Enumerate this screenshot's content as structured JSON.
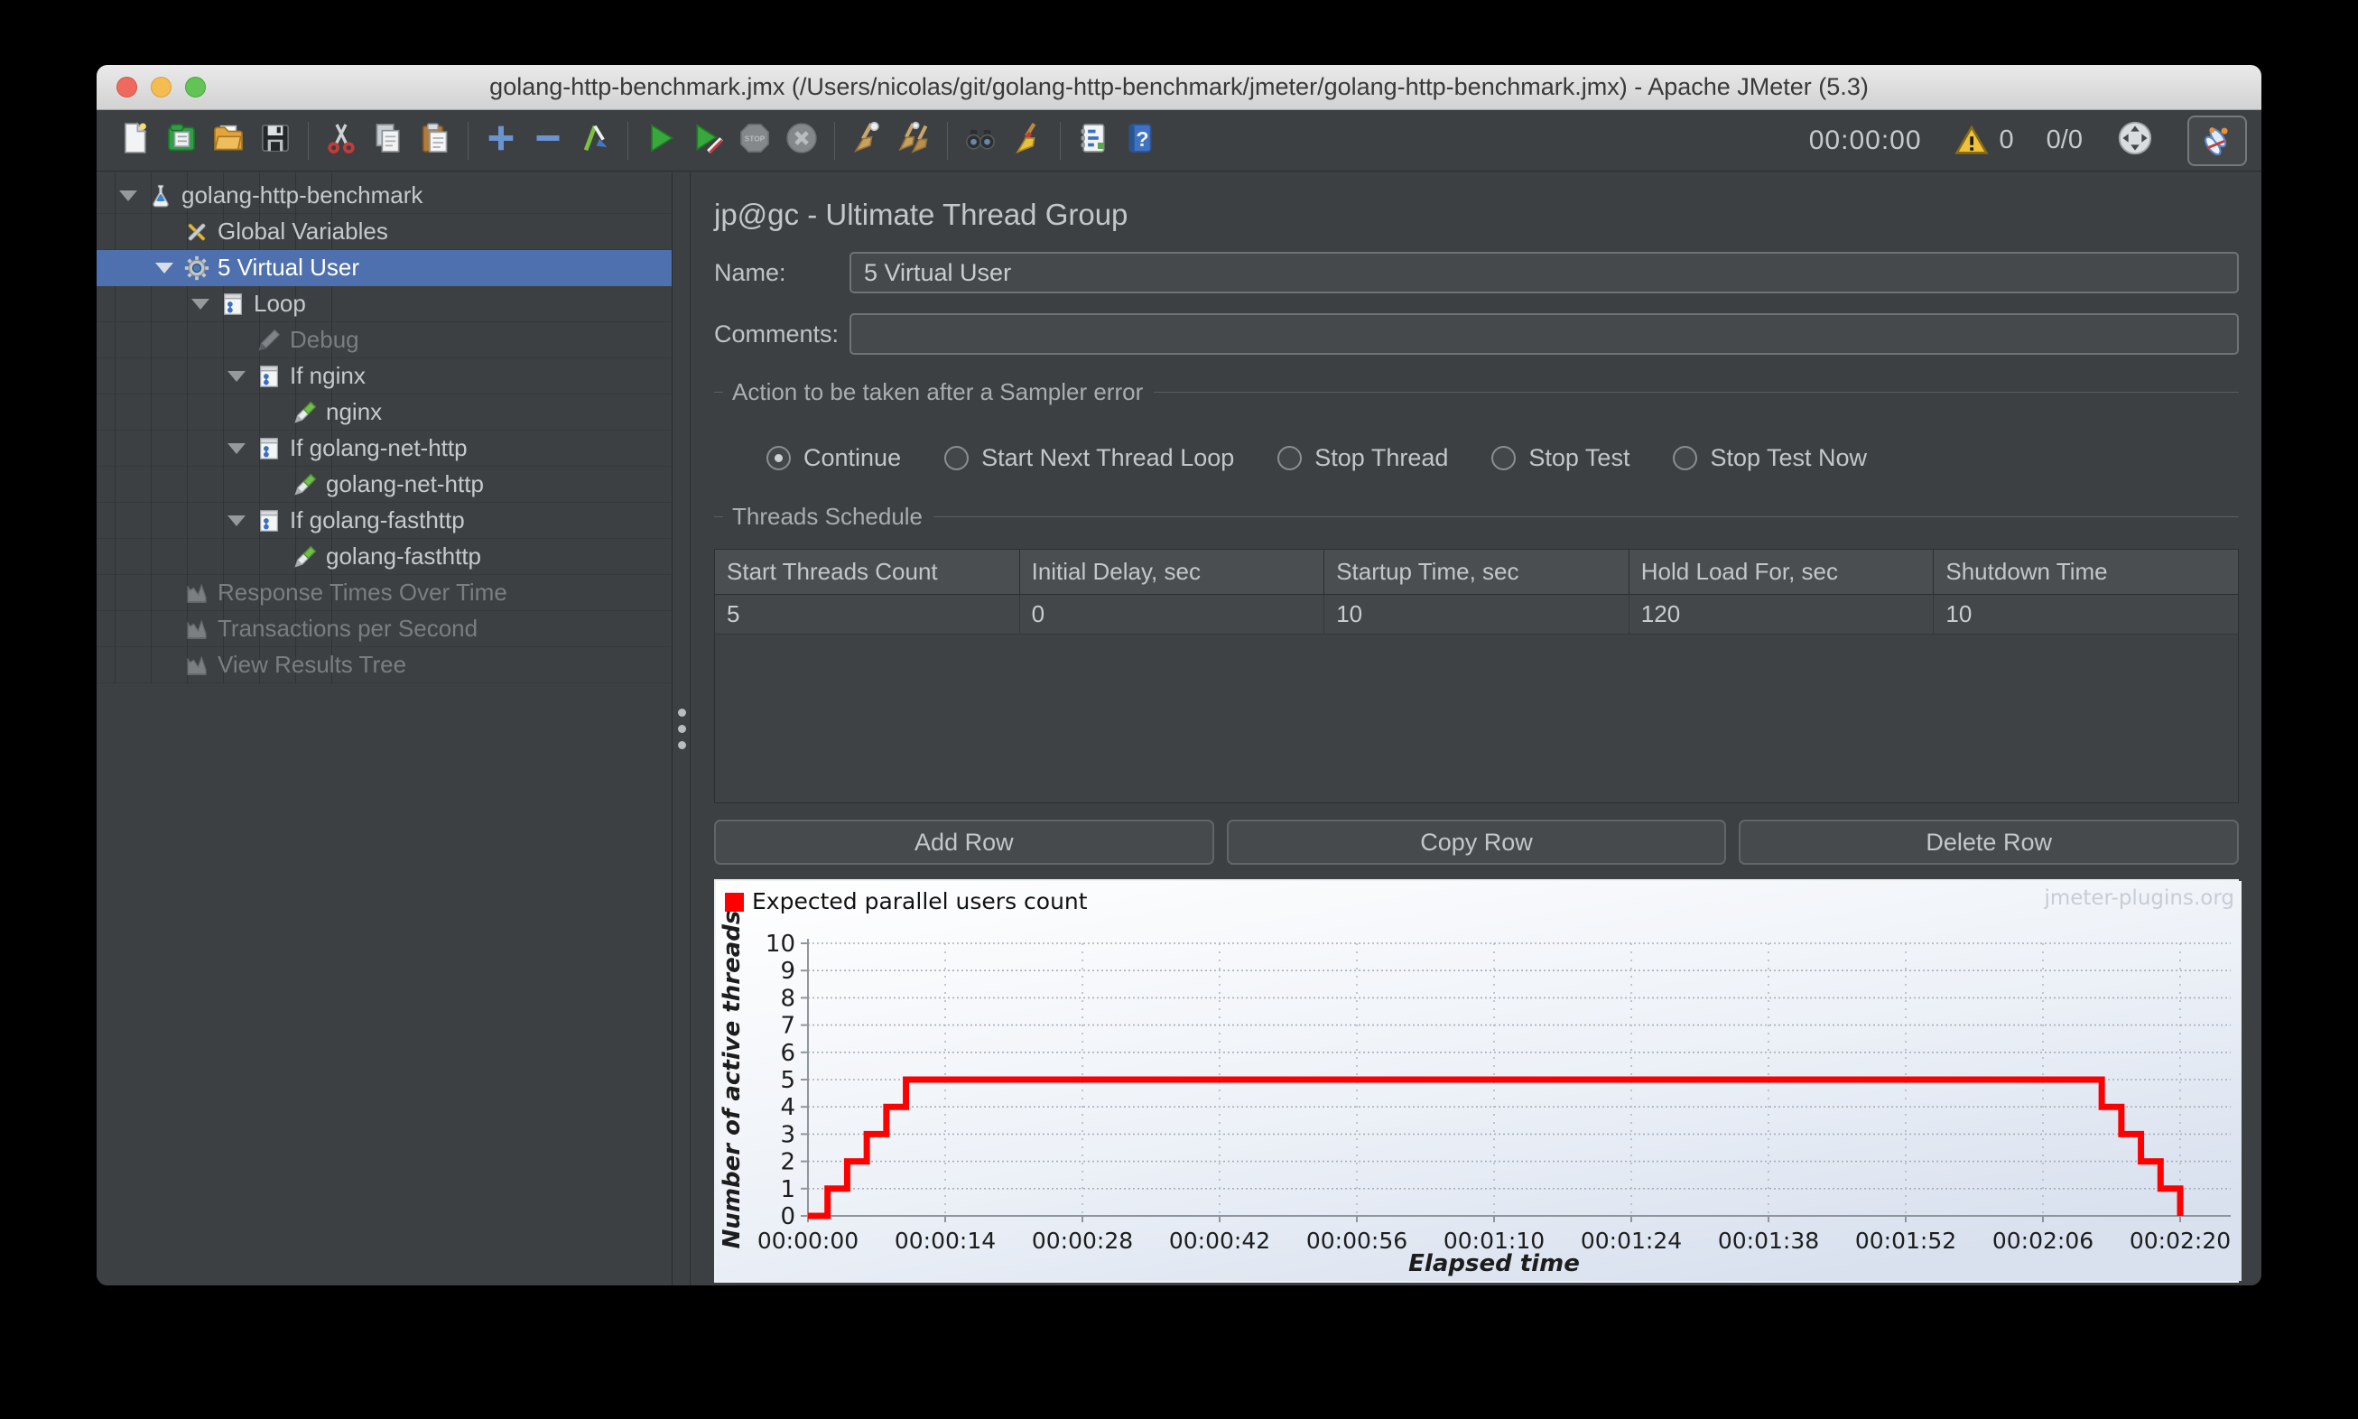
{
  "window": {
    "title": "golang-http-benchmark.jmx (/Users/nicolas/git/golang-http-benchmark/jmeter/golang-http-benchmark.jmx) - Apache JMeter (5.3)"
  },
  "toolbar": {
    "icon_groups": [
      [
        "new-file-icon",
        "templates-icon",
        "open-file-icon",
        "save-icon"
      ],
      [
        "cut-icon",
        "copy-icon",
        "paste-icon"
      ],
      [
        "add-icon",
        "subtract-icon",
        "toggle-icon"
      ],
      [
        "start-icon",
        "start-no-pauses-icon",
        "stop-icon",
        "shutdown-icon"
      ],
      [
        "clear-icon",
        "clear-all-icon"
      ],
      [
        "search-icon",
        "search-reset-icon"
      ],
      [
        "function-helper-icon",
        "help-icon"
      ]
    ],
    "timer": "00:00:00",
    "warning_count": "0",
    "thread_counter": "0/0"
  },
  "tree": {
    "items": [
      {
        "label": "golang-http-benchmark",
        "level": 0,
        "icon": "test-plan-flask-icon",
        "expanded": true
      },
      {
        "label": "Global Variables",
        "level": 1,
        "icon": "arguments-tools-icon"
      },
      {
        "label": "5 Virtual User",
        "level": 1,
        "icon": "thread-group-gear-icon",
        "expanded": true,
        "selected": true
      },
      {
        "label": "Loop",
        "level": 2,
        "icon": "controller-icon",
        "expanded": true
      },
      {
        "label": "Debug",
        "level": 3,
        "icon": "pencil-gray-icon",
        "disabled": true
      },
      {
        "label": "If nginx",
        "level": 3,
        "icon": "controller-icon",
        "expanded": true
      },
      {
        "label": "nginx",
        "level": 4,
        "icon": "pencil-green-icon"
      },
      {
        "label": "If golang-net-http",
        "level": 3,
        "icon": "controller-icon",
        "expanded": true
      },
      {
        "label": "golang-net-http",
        "level": 4,
        "icon": "pencil-green-icon"
      },
      {
        "label": "If golang-fasthttp",
        "level": 3,
        "icon": "controller-icon",
        "expanded": true
      },
      {
        "label": "golang-fasthttp",
        "level": 4,
        "icon": "pencil-green-icon"
      },
      {
        "label": "Response Times Over Time",
        "level": 1,
        "icon": "chart-listener-icon",
        "disabled": true
      },
      {
        "label": "Transactions per Second",
        "level": 1,
        "icon": "chart-listener-icon",
        "disabled": true
      },
      {
        "label": "View Results Tree",
        "level": 1,
        "icon": "chart-listener-icon",
        "disabled": true
      }
    ]
  },
  "main": {
    "title": "jp@gc - Ultimate Thread Group",
    "name_label": "Name:",
    "name_value": "5 Virtual User",
    "comments_label": "Comments:",
    "comments_value": "",
    "sampler_error": {
      "legend": "Action to be taken after a Sampler error",
      "options": [
        {
          "label": "Continue",
          "selected": true
        },
        {
          "label": "Start Next Thread Loop",
          "selected": false
        },
        {
          "label": "Stop Thread",
          "selected": false
        },
        {
          "label": "Stop Test",
          "selected": false
        },
        {
          "label": "Stop Test Now",
          "selected": false
        }
      ]
    },
    "threads_schedule": {
      "legend": "Threads Schedule",
      "columns": [
        "Start Threads Count",
        "Initial Delay, sec",
        "Startup Time, sec",
        "Hold Load For, sec",
        "Shutdown Time"
      ],
      "rows": [
        [
          "5",
          "0",
          "10",
          "120",
          "10"
        ]
      ],
      "buttons": [
        "Add Row",
        "Copy Row",
        "Delete Row"
      ]
    }
  },
  "chart_data": {
    "type": "line",
    "style": "step",
    "legend": [
      {
        "label": "Expected parallel users count",
        "color": "#ff0000"
      }
    ],
    "watermark": "jmeter-plugins.org",
    "xlabel": "Elapsed time",
    "ylabel": "Number of active threads",
    "x_ticks": [
      "00:00:00",
      "00:00:14",
      "00:00:28",
      "00:00:42",
      "00:00:56",
      "00:01:10",
      "00:01:24",
      "00:01:38",
      "00:01:52",
      "00:02:06",
      "00:02:20"
    ],
    "x_tick_seconds": [
      0,
      14,
      28,
      42,
      56,
      70,
      84,
      98,
      112,
      126,
      140
    ],
    "y_ticks": [
      0,
      1,
      2,
      3,
      4,
      5,
      6,
      7,
      8,
      9,
      10
    ],
    "ylim": [
      0,
      10
    ],
    "grid": true,
    "legend_position": "top-left",
    "series": [
      {
        "name": "Expected parallel users count",
        "color": "#ff0000",
        "points": [
          [
            0,
            0
          ],
          [
            2,
            0
          ],
          [
            2,
            1
          ],
          [
            4,
            1
          ],
          [
            4,
            2
          ],
          [
            6,
            2
          ],
          [
            6,
            3
          ],
          [
            8,
            3
          ],
          [
            8,
            4
          ],
          [
            10,
            4
          ],
          [
            10,
            5
          ],
          [
            132,
            5
          ],
          [
            132,
            4
          ],
          [
            134,
            4
          ],
          [
            134,
            3
          ],
          [
            136,
            3
          ],
          [
            136,
            2
          ],
          [
            138,
            2
          ],
          [
            138,
            1
          ],
          [
            140,
            1
          ],
          [
            140,
            0
          ]
        ]
      }
    ]
  },
  "colors": {
    "selection_blue": "#4e70af",
    "chart_line_red": "#ff0000",
    "warning_yellow": "#f0c23a",
    "panel_bg": "#3d4043",
    "traffic_red": "#ee6a5f",
    "traffic_yellow": "#f5bd4f",
    "traffic_green": "#61c454"
  }
}
